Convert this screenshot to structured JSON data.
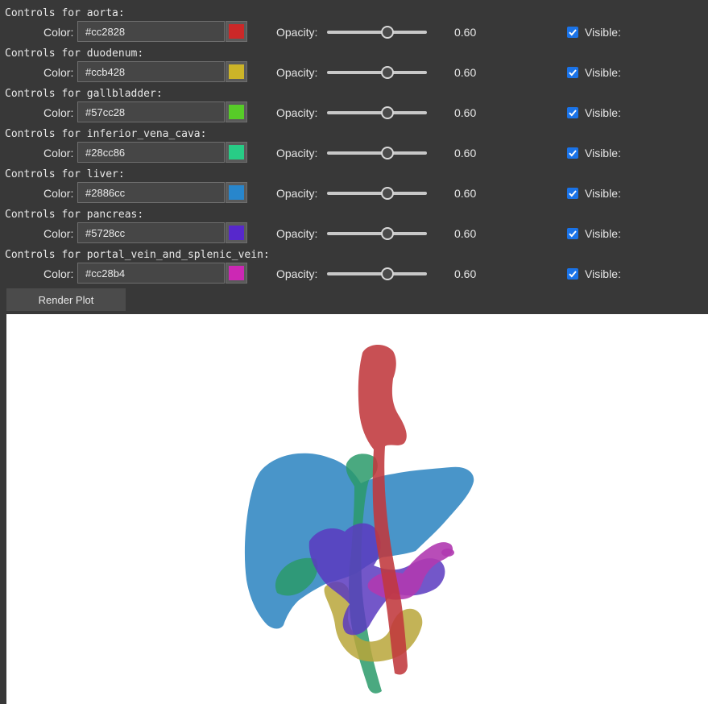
{
  "controls": [
    {
      "title": "Controls for aorta:",
      "color_label": "Color:",
      "color_value": "#cc2828",
      "swatch": "#cc2828",
      "opacity_label": "Opacity:",
      "opacity": 0.6,
      "opacity_text": "0.60",
      "visible_label": "Visible:",
      "visible": true
    },
    {
      "title": "Controls for duodenum:",
      "color_label": "Color:",
      "color_value": "#ccb428",
      "swatch": "#ccb428",
      "opacity_label": "Opacity:",
      "opacity": 0.6,
      "opacity_text": "0.60",
      "visible_label": "Visible:",
      "visible": true
    },
    {
      "title": "Controls for gallbladder:",
      "color_label": "Color:",
      "color_value": "#57cc28",
      "swatch": "#57cc28",
      "opacity_label": "Opacity:",
      "opacity": 0.6,
      "opacity_text": "0.60",
      "visible_label": "Visible:",
      "visible": true
    },
    {
      "title": "Controls for inferior_vena_cava:",
      "color_label": "Color:",
      "color_value": "#28cc86",
      "swatch": "#28cc86",
      "opacity_label": "Opacity:",
      "opacity": 0.6,
      "opacity_text": "0.60",
      "visible_label": "Visible:",
      "visible": true
    },
    {
      "title": "Controls for liver:",
      "color_label": "Color:",
      "color_value": "#2886cc",
      "swatch": "#2886cc",
      "opacity_label": "Opacity:",
      "opacity": 0.6,
      "opacity_text": "0.60",
      "visible_label": "Visible:",
      "visible": true
    },
    {
      "title": "Controls for pancreas:",
      "color_label": "Color:",
      "color_value": "#5728cc",
      "swatch": "#5728cc",
      "opacity_label": "Opacity:",
      "opacity": 0.6,
      "opacity_text": "0.60",
      "visible_label": "Visible:",
      "visible": true
    },
    {
      "title": "Controls for portal_vein_and_splenic_vein:",
      "color_label": "Color:",
      "color_value": "#cc28b4",
      "swatch": "#cc28b4",
      "opacity_label": "Opacity:",
      "opacity": 0.6,
      "opacity_text": "0.60",
      "visible_label": "Visible:",
      "visible": true
    }
  ],
  "render_button": "Render Plot",
  "rendered_colors": {
    "aorta": "#c0383c",
    "duodenum": "#b8a63a",
    "gallbladder": "#3e9a4a",
    "inferior_vena_cava": "#2a9a6a",
    "liver": "#3a8cc4",
    "pancreas": "#5a3ac0",
    "portal_vein_and_splenic_vein": "#b03ab0"
  }
}
